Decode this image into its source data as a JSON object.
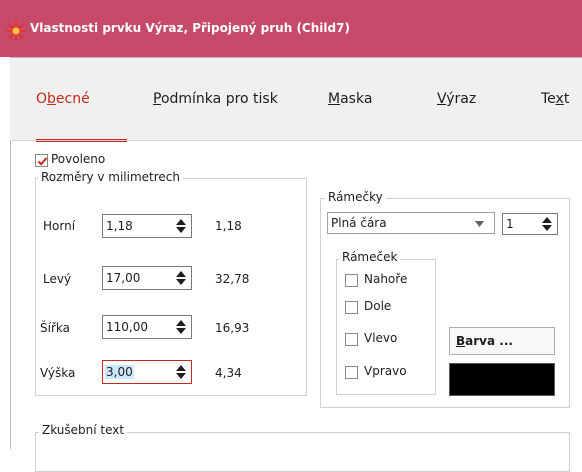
{
  "window": {
    "title": "Vlastnosti prvku Výraz, Připojený pruh (Child7)",
    "title_bar_color": "#c74a6a",
    "accent_color": "#c42b1c"
  },
  "tabs": [
    {
      "label": "Obecné",
      "shortcut": "b",
      "active": true
    },
    {
      "label": "Podmínka pro tisk",
      "shortcut": "P",
      "active": false
    },
    {
      "label": "Maska",
      "shortcut": "M",
      "active": false
    },
    {
      "label": "Výraz",
      "shortcut": "V",
      "active": false
    },
    {
      "label": "Text",
      "shortcut": "x",
      "active": false
    }
  ],
  "enabled": {
    "label": "Povoleno",
    "checked": true
  },
  "dimensions": {
    "title": "Rozměry v milimetrech",
    "rows": [
      {
        "label": "Horní",
        "input": "1,18",
        "computed": "1,18"
      },
      {
        "label": "Levý",
        "input": "17,00",
        "computed": "32,78"
      },
      {
        "label": "Šířka",
        "input": "110,00",
        "computed": "16,93"
      },
      {
        "label": "Výška",
        "input": "3,00",
        "computed": "4,34",
        "focused": true
      }
    ]
  },
  "borders": {
    "title": "Rámečky",
    "line_style": "Plná čára",
    "line_width": "1",
    "frame": {
      "title": "Rámeček",
      "options": [
        {
          "label": "Nahoře",
          "checked": false
        },
        {
          "label": "Dole",
          "checked": false
        },
        {
          "label": "Vlevo",
          "checked": false
        },
        {
          "label": "Vpravo",
          "checked": false
        }
      ]
    },
    "color_button": "Barva ...",
    "color_button_shortcut": "B",
    "color_value": "#000000"
  },
  "sample_text": {
    "title": "Zkušební text"
  }
}
